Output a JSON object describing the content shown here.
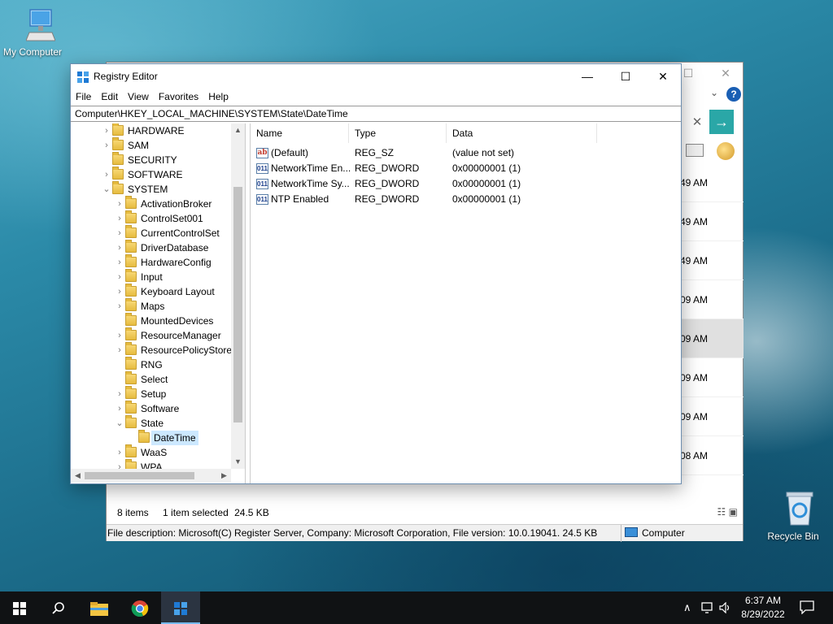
{
  "desktop": {
    "icons": [
      {
        "label": "My Computer",
        "icon": "monitor-icon"
      },
      {
        "label": "Recycle Bin",
        "icon": "recycle-bin-icon"
      }
    ]
  },
  "background_window": {
    "status": {
      "items": "8 items",
      "selected": "1 item selected",
      "size": "24.5 KB"
    },
    "times": [
      "49 AM",
      "49 AM",
      "49 AM",
      "09 AM",
      "09 AM",
      "09 AM",
      "09 AM",
      "08 AM"
    ],
    "description": "File description: Microsoft(C) Register Server, Company: Microsoft Corporation, File version: 10.0.19041.  24.5 KB",
    "location": "Computer"
  },
  "regedit": {
    "title": "Registry Editor",
    "menu": [
      "File",
      "Edit",
      "View",
      "Favorites",
      "Help"
    ],
    "address": "Computer\\HKEY_LOCAL_MACHINE\\SYSTEM\\State\\DateTime",
    "tree": [
      {
        "label": "HARDWARE",
        "level": 0,
        "expander": ">"
      },
      {
        "label": "SAM",
        "level": 0,
        "expander": ">"
      },
      {
        "label": "SECURITY",
        "level": 0,
        "expander": ""
      },
      {
        "label": "SOFTWARE",
        "level": 0,
        "expander": ">"
      },
      {
        "label": "SYSTEM",
        "level": 0,
        "expander": "v"
      },
      {
        "label": "ActivationBroker",
        "level": 1,
        "expander": ">"
      },
      {
        "label": "ControlSet001",
        "level": 1,
        "expander": ">"
      },
      {
        "label": "CurrentControlSet",
        "level": 1,
        "expander": ">"
      },
      {
        "label": "DriverDatabase",
        "level": 1,
        "expander": ">"
      },
      {
        "label": "HardwareConfig",
        "level": 1,
        "expander": ">"
      },
      {
        "label": "Input",
        "level": 1,
        "expander": ">"
      },
      {
        "label": "Keyboard Layout",
        "level": 1,
        "expander": ">"
      },
      {
        "label": "Maps",
        "level": 1,
        "expander": ">"
      },
      {
        "label": "MountedDevices",
        "level": 1,
        "expander": ""
      },
      {
        "label": "ResourceManager",
        "level": 1,
        "expander": ">"
      },
      {
        "label": "ResourcePolicyStore",
        "level": 1,
        "expander": ">"
      },
      {
        "label": "RNG",
        "level": 1,
        "expander": ""
      },
      {
        "label": "Select",
        "level": 1,
        "expander": ""
      },
      {
        "label": "Setup",
        "level": 1,
        "expander": ">"
      },
      {
        "label": "Software",
        "level": 1,
        "expander": ">"
      },
      {
        "label": "State",
        "level": 1,
        "expander": "v"
      },
      {
        "label": "DateTime",
        "level": 2,
        "expander": "",
        "selected": true
      },
      {
        "label": "WaaS",
        "level": 1,
        "expander": ">"
      },
      {
        "label": "WPA",
        "level": 1,
        "expander": ">"
      }
    ],
    "columns": [
      "Name",
      "Type",
      "Data"
    ],
    "values": [
      {
        "name": "(Default)",
        "type": "REG_SZ",
        "data": "(value not set)",
        "icon": "ab"
      },
      {
        "name": "NetworkTime En...",
        "type": "REG_DWORD",
        "data": "0x00000001 (1)",
        "icon": "011"
      },
      {
        "name": "NetworkTime Sy...",
        "type": "REG_DWORD",
        "data": "0x00000001 (1)",
        "icon": "011"
      },
      {
        "name": "NTP Enabled",
        "type": "REG_DWORD",
        "data": "0x00000001 (1)",
        "icon": "011"
      }
    ]
  },
  "taskbar": {
    "time": "6:37 AM",
    "date": "8/29/2022"
  }
}
